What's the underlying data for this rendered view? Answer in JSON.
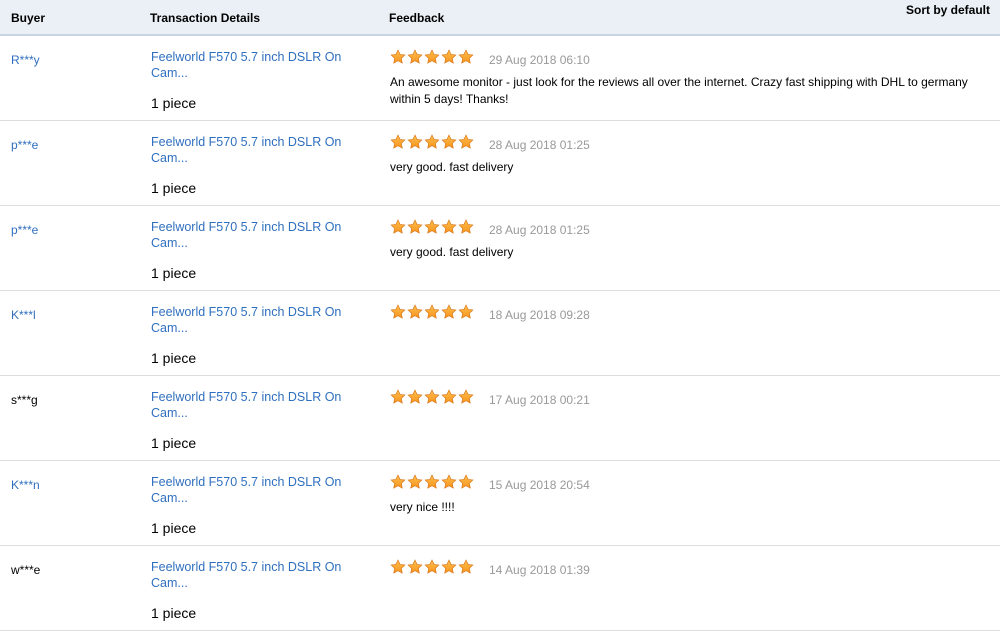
{
  "header": {
    "buyer": "Buyer",
    "transaction": "Transaction Details",
    "feedback": "Feedback",
    "sort": "Sort by default"
  },
  "colors": {
    "link": "#2f6fbf",
    "star_fill": "#f7931e",
    "date": "#999999",
    "header_bg": "#eaf0f6"
  },
  "rows": [
    {
      "buyer": "R***y",
      "buyer_link": true,
      "product": "Feelworld F570 5.7 inch DSLR On Cam...",
      "quantity": "1 piece",
      "stars": 5,
      "date": "29 Aug 2018 06:10",
      "comment": "An awesome monitor - just look for the reviews all over the internet. Crazy fast shipping with DHL to germany within 5 days! Thanks!"
    },
    {
      "buyer": "p***e",
      "buyer_link": true,
      "product": "Feelworld F570 5.7 inch DSLR On Cam...",
      "quantity": "1 piece",
      "stars": 5,
      "date": "28 Aug 2018 01:25",
      "comment": "very good. fast delivery"
    },
    {
      "buyer": "p***e",
      "buyer_link": true,
      "product": "Feelworld F570 5.7 inch DSLR On Cam...",
      "quantity": "1 piece",
      "stars": 5,
      "date": "28 Aug 2018 01:25",
      "comment": "very good. fast delivery"
    },
    {
      "buyer": "K***l",
      "buyer_link": true,
      "product": "Feelworld F570 5.7 inch DSLR On Cam...",
      "quantity": "1 piece",
      "stars": 5,
      "date": "18 Aug 2018 09:28",
      "comment": ""
    },
    {
      "buyer": "s***g",
      "buyer_link": false,
      "product": "Feelworld F570 5.7 inch DSLR On Cam...",
      "quantity": "1 piece",
      "stars": 5,
      "date": "17 Aug 2018 00:21",
      "comment": ""
    },
    {
      "buyer": "K***n",
      "buyer_link": true,
      "product": "Feelworld F570 5.7 inch DSLR On Cam...",
      "quantity": "1 piece",
      "stars": 5,
      "date": "15 Aug 2018 20:54",
      "comment": "very nice !!!!"
    },
    {
      "buyer": "w***e",
      "buyer_link": false,
      "product": "Feelworld F570 5.7 inch DSLR On Cam...",
      "quantity": "1 piece",
      "stars": 5,
      "date": "14 Aug 2018 01:39",
      "comment": ""
    }
  ]
}
